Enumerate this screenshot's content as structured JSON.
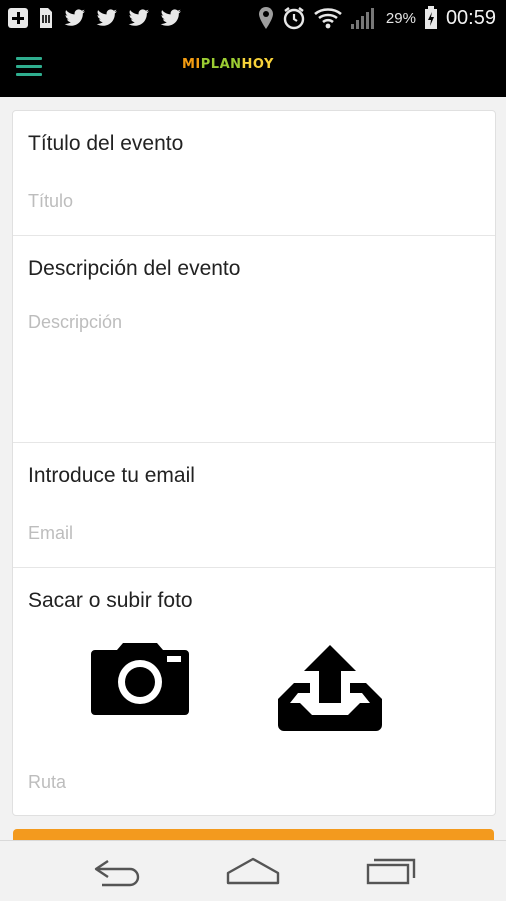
{
  "status_bar": {
    "battery_percent": "29%",
    "time": "00:59"
  },
  "app": {
    "logo": {
      "part1": "MI",
      "part2": "PLAN",
      "part3": "HOY"
    },
    "colors": {
      "accent_menu": "#2fae8f",
      "button": "#f39a1e"
    }
  },
  "form": {
    "title": {
      "label": "Título del evento",
      "placeholder": "Título"
    },
    "description": {
      "label": "Descripción del evento",
      "placeholder": "Descripción"
    },
    "email": {
      "label": "Introduce tu email",
      "placeholder": "Email"
    },
    "photo": {
      "label": "Sacar o subir foto",
      "path_placeholder": "Ruta"
    }
  },
  "icons": {
    "status_left": [
      "plus-icon",
      "file-icon",
      "twitter-icon",
      "twitter-icon",
      "twitter-icon",
      "twitter-icon"
    ],
    "status_right": [
      "location-icon",
      "alarm-icon",
      "wifi-icon",
      "signal-icon",
      "battery-icon"
    ],
    "photo_actions": [
      "camera-icon",
      "upload-icon"
    ],
    "nav": [
      "back-icon",
      "home-icon",
      "recents-icon"
    ]
  }
}
